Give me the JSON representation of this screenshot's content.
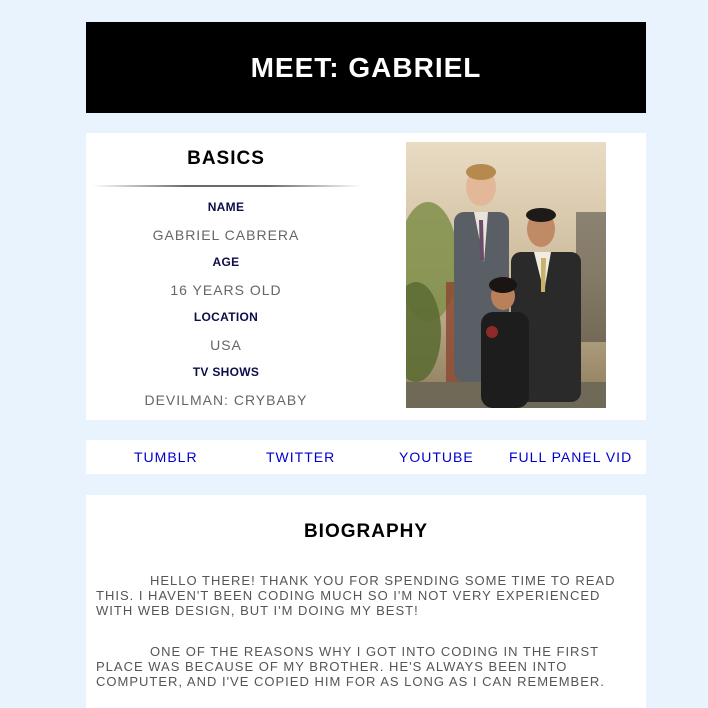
{
  "header": {
    "title": "MEET: GABRIEL"
  },
  "basics": {
    "title": "BASICS",
    "fields": [
      {
        "label": "NAME",
        "value": "GABRIEL CABRERA"
      },
      {
        "label": "AGE",
        "value": "16 YEARS OLD"
      },
      {
        "label": "LOCATION",
        "value": "USA"
      },
      {
        "label": "TV SHOWS",
        "value": "DEVILMAN: CRYBABY"
      }
    ]
  },
  "links": [
    {
      "label": "TUMBLR"
    },
    {
      "label": "TWITTER"
    },
    {
      "label": "YOUTUBE"
    },
    {
      "label": "FULL PANEL VID"
    }
  ],
  "biography": {
    "title": "BIOGRAPHY",
    "paragraphs": [
      "HELLO THERE! THANK YOU FOR SPENDING SOME TIME TO READ THIS. I HAVEN'T BEEN CODING MUCH SO I'M NOT VERY EXPERIENCED WITH WEB DESIGN, BUT I'M DOING MY BEST!",
      "ONE OF THE REASONS WHY I GOT INTO CODING IN THE FIRST PLACE WAS BECAUSE OF MY BROTHER. HE'S ALWAYS BEEN INTO COMPUTER, AND I'VE COPIED HIM FOR AS LONG AS I CAN REMEMBER."
    ]
  },
  "colors": {
    "page_background": "#e8f3fd",
    "header_background": "#000000",
    "link": "#0000cc",
    "label": "#0d0d4a",
    "value": "#666666"
  }
}
